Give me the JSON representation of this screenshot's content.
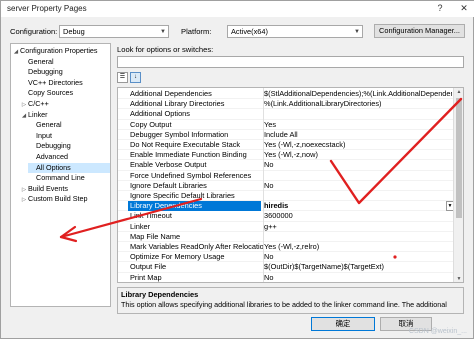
{
  "window": {
    "title": "server Property Pages",
    "help_glyph": "?",
    "close_glyph": "✕"
  },
  "toolbar": {
    "configuration_label": "Configuration:",
    "configuration_value": "Debug",
    "platform_label": "Platform:",
    "platform_value": "Active(x64)",
    "config_manager_label": "Configuration Manager...",
    "dropdown_glyph": "▼"
  },
  "tree": {
    "items": [
      {
        "label": "Configuration Properties",
        "twisty": "◢"
      },
      {
        "label": "General",
        "twisty": ""
      },
      {
        "label": "Debugging",
        "twisty": ""
      },
      {
        "label": "VC++ Directories",
        "twisty": ""
      },
      {
        "label": "Copy Sources",
        "twisty": ""
      },
      {
        "label": "C/C++",
        "twisty": "▷"
      },
      {
        "label": "Linker",
        "twisty": "◢"
      },
      {
        "label": "General",
        "twisty": ""
      },
      {
        "label": "Input",
        "twisty": ""
      },
      {
        "label": "Debugging",
        "twisty": ""
      },
      {
        "label": "Advanced",
        "twisty": ""
      },
      {
        "label": "All Options",
        "twisty": ""
      },
      {
        "label": "Command Line",
        "twisty": ""
      },
      {
        "label": "Build Events",
        "twisty": "▷"
      },
      {
        "label": "Custom Build Step",
        "twisty": "▷"
      }
    ]
  },
  "right": {
    "search_label": "Look for options or switches:",
    "search_value": "",
    "sort_icon_glyph": "☰",
    "category_icon_glyph": "↓"
  },
  "grid": {
    "rows": [
      {
        "name": "Additional Dependencies",
        "value": "$(StlAdditionalDependencies);%(Link.AdditionalDependencies)"
      },
      {
        "name": "Additional Library Directories",
        "value": "%(Link.AdditionalLibraryDirectories)"
      },
      {
        "name": "Additional Options",
        "value": ""
      },
      {
        "name": "Copy Output",
        "value": "Yes"
      },
      {
        "name": "Debugger Symbol Information",
        "value": "Include All"
      },
      {
        "name": "Do Not Require Executable Stack",
        "value": "Yes (-Wl,-z,noexecstack)"
      },
      {
        "name": "Enable Immediate Function Binding",
        "value": "Yes (-Wl,-z,now)"
      },
      {
        "name": "Enable Verbose Output",
        "value": "No"
      },
      {
        "name": "Force Undefined Symbol References",
        "value": ""
      },
      {
        "name": "Ignore Default Libraries",
        "value": "No"
      },
      {
        "name": "Ignore Specific Default Libraries",
        "value": ""
      },
      {
        "name": "Library Dependencies",
        "value": "hiredis"
      },
      {
        "name": "Link Timeout",
        "value": "3600000"
      },
      {
        "name": "Linker",
        "value": "g++"
      },
      {
        "name": "Map File Name",
        "value": ""
      },
      {
        "name": "Mark Variables ReadOnly After Relocation",
        "value": "Yes (-Wl,-z,relro)"
      },
      {
        "name": "Optimize For Memory Usage",
        "value": "No"
      },
      {
        "name": "Output File",
        "value": "$(OutDir)$(TargetName)$(TargetExt)"
      },
      {
        "name": "Print Map",
        "value": "No"
      }
    ],
    "selected_dropdown_glyph": "▼",
    "scroll_up_glyph": "▲",
    "scroll_down_glyph": "▼"
  },
  "description": {
    "title": "Library Dependencies",
    "text": "This option allows specifying additional libraries to be  added to the linker command line. The additional"
  },
  "footer": {
    "ok_label": "确定",
    "cancel_label": "取消",
    "watermark": "CSDN @weixin_..."
  },
  "colors": {
    "accent": "#0078d7",
    "annotation_red": "#e02020"
  }
}
